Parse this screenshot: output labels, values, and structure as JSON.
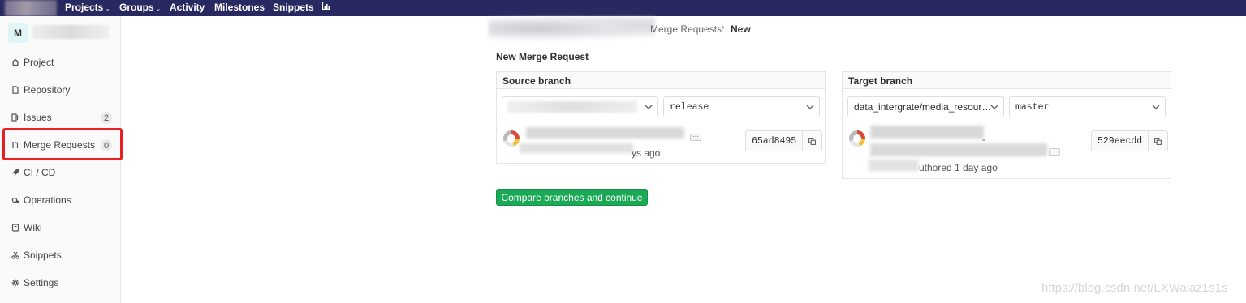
{
  "navbar": {
    "items": [
      {
        "label": "Projects",
        "caret": "⌄"
      },
      {
        "label": "Groups",
        "caret": "⌄"
      },
      {
        "label": "Activity"
      },
      {
        "label": "Milestones"
      },
      {
        "label": "Snippets"
      }
    ],
    "chart_icon": "bar-chart-icon",
    "background": "#292961"
  },
  "sidebar": {
    "avatar_letter": "M",
    "items": [
      {
        "label": "Project",
        "icon": "home-icon"
      },
      {
        "label": "Repository",
        "icon": "doc-icon"
      },
      {
        "label": "Issues",
        "icon": "issues-icon",
        "badge": "2"
      },
      {
        "label": "Merge Requests",
        "icon": "merge-request-icon",
        "badge": "0"
      },
      {
        "label": "CI / CD",
        "icon": "rocket-icon"
      },
      {
        "label": "Operations",
        "icon": "cloud-gear-icon"
      },
      {
        "label": "Wiki",
        "icon": "book-icon"
      },
      {
        "label": "Snippets",
        "icon": "scissors-icon"
      },
      {
        "label": "Settings",
        "icon": "gear-icon"
      }
    ],
    "highlight_color": "#ea1f1f"
  },
  "breadcrumb": {
    "parent": "Merge Requests",
    "separator": "›",
    "current": "New"
  },
  "page": {
    "title": "New Merge Request",
    "source": {
      "header": "Source branch",
      "branch": "release",
      "sha": "65ad8495",
      "time": "ys ago"
    },
    "target": {
      "header": "Target branch",
      "project": "data_intergrate/media_resour…",
      "branch": "master",
      "sha": "529eecdd",
      "time": "uthored 1 day ago",
      "time_dash": "-"
    },
    "compare_button": "Compare branches and continue",
    "ellipsis": "···"
  },
  "watermark": "https://blog.csdn.net/LXWalaz1s1s",
  "colors": {
    "accent_green": "#1aaa55",
    "text": "#2e2e2e"
  }
}
